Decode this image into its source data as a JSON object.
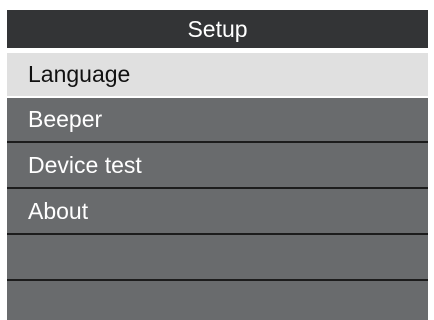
{
  "colors": {
    "title_bar": "#333436",
    "item_background": "#696b6d",
    "selected_background": "#e0e0e0",
    "divider": "#1c1c1c",
    "text_light": "#ffffff",
    "text_dark": "#111111"
  },
  "header": {
    "title": "Setup"
  },
  "menu": {
    "selected_index": 0,
    "items": [
      {
        "label": "Language"
      },
      {
        "label": "Beeper"
      },
      {
        "label": "Device test"
      },
      {
        "label": "About"
      },
      {
        "label": ""
      },
      {
        "label": ""
      }
    ]
  }
}
